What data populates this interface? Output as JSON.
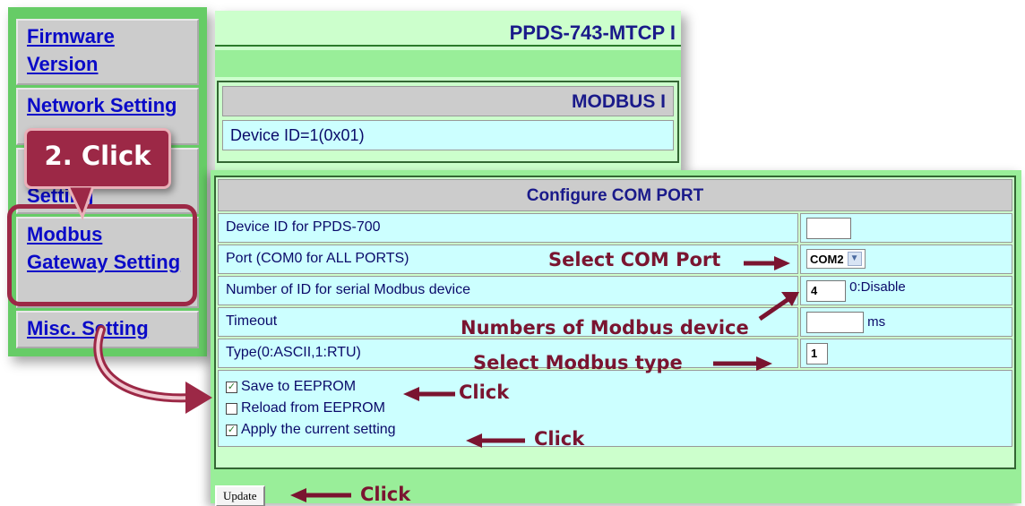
{
  "nav": {
    "firmware": "Firmware Version",
    "network": "Network Setting",
    "hidden_item": "Setting",
    "modbus": "Modbus Gateway Setting",
    "misc": "Misc. Setting"
  },
  "top_page": {
    "title": "PPDS-743-MTCP I",
    "modbus_header": "MODBUS I",
    "device_id": "Device ID=1(0x01)"
  },
  "config": {
    "header": "Configure COM PORT",
    "rows": [
      {
        "label": "Device ID for PPDS-700",
        "value": ""
      },
      {
        "label": "Port (COM0 for ALL PORTS)",
        "value": "COM2"
      },
      {
        "label": "Number of ID for serial Modbus device",
        "value": "4",
        "suffix": "0:Disable"
      },
      {
        "label": "Timeout",
        "value": "",
        "suffix": "ms"
      },
      {
        "label": "Type(0:ASCII,1:RTU)",
        "value": "1"
      }
    ],
    "options": [
      {
        "label": "Save to EEPROM",
        "checked": true
      },
      {
        "label": "Reload from EEPROM",
        "checked": false
      },
      {
        "label": "Apply the current setting",
        "checked": true
      }
    ],
    "update_label": "Update"
  },
  "annotations": {
    "callout": "2. Click",
    "select_com": "Select COM Port",
    "num_devices": "Numbers of Modbus device",
    "select_type": "Select Modbus type",
    "click_save": "Click",
    "click_apply": "Click",
    "click_update": "Click",
    "color": "#7a1430"
  }
}
